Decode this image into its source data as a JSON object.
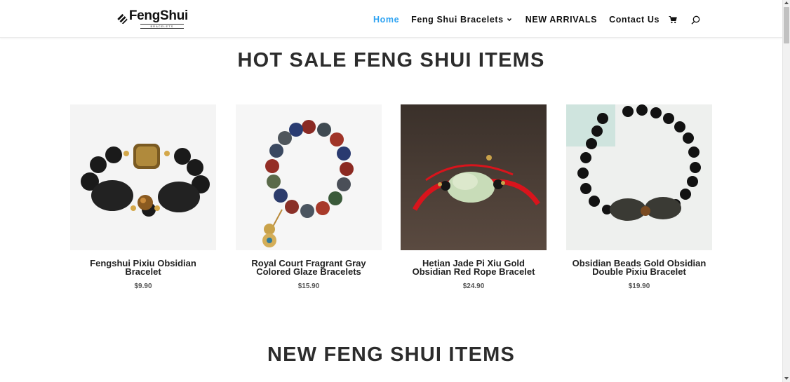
{
  "header": {
    "logo": {
      "name": "FengShui",
      "sub": "BRACELETS"
    },
    "nav": [
      {
        "label": "Home",
        "active": true
      },
      {
        "label": "Feng Shui Bracelets",
        "has_dropdown": true
      },
      {
        "label": "NEW ARRIVALS"
      },
      {
        "label": "Contact Us"
      }
    ],
    "icons": [
      "cart-icon",
      "search-icon"
    ]
  },
  "sections": {
    "hot_sale": {
      "title": "HOT SALE FENG SHUI ITEMS"
    },
    "new_items": {
      "title": "NEW FENG SHUI ITEMS"
    }
  },
  "products": [
    {
      "name": "Fengshui Pixiu Obsidian Bracelet",
      "price": "$9.90"
    },
    {
      "name": "Royal Court Fragrant Gray Colored Glaze Bracelets",
      "price": "$15.90"
    },
    {
      "name": "Hetian Jade Pi Xiu Gold Obsidian Red Rope Bracelet",
      "price": "$24.90"
    },
    {
      "name": "Obsidian Beads Gold Obsidian Double Pixiu Bracelet",
      "price": "$19.90"
    }
  ],
  "colors": {
    "accent": "#2ea3f2",
    "heading": "#2c2c2c"
  }
}
